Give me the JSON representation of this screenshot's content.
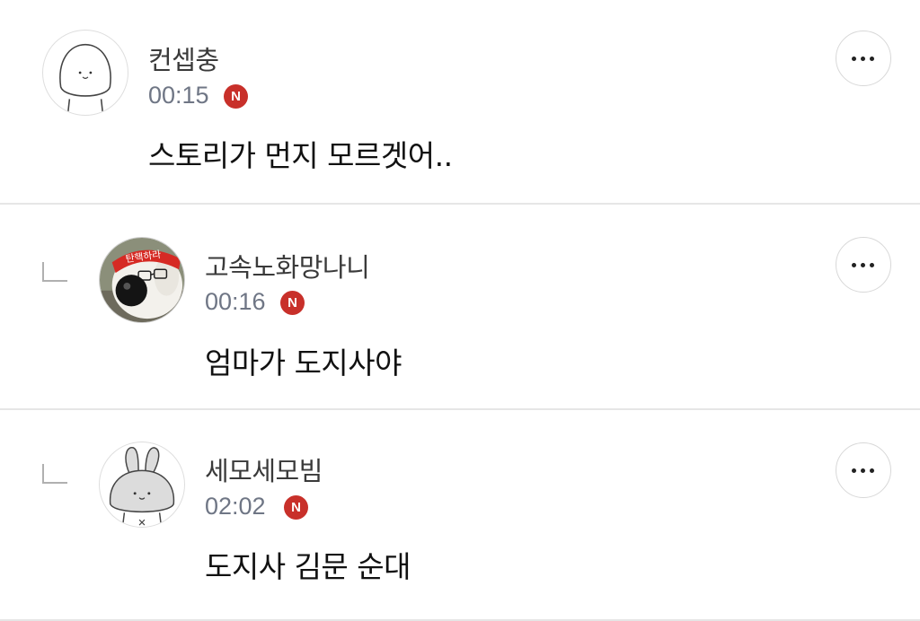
{
  "comments": [
    {
      "author": "컨셉충",
      "time": "00:15",
      "badge": "N",
      "text": "스토리가 먼지 모르겟어..",
      "is_reply": false,
      "avatar_icon": "plain-smiling-blob-icon"
    },
    {
      "author": "고속노화망나니",
      "time": "00:16",
      "badge": "N",
      "text": "엄마가 도지사야",
      "is_reply": true,
      "avatar_icon": "polar-bear-headband-icon",
      "avatar_headband_text": "탄핵하라"
    },
    {
      "author": "세모세모빔",
      "time": "02:02",
      "badge": "N",
      "text": "도지사 김문 순대",
      "is_reply": true,
      "avatar_icon": "rabbit-icon"
    }
  ],
  "colors": {
    "badge": "#c8302a",
    "time": "#6f7685",
    "divider": "#e6e6e6",
    "text": "#111111"
  }
}
